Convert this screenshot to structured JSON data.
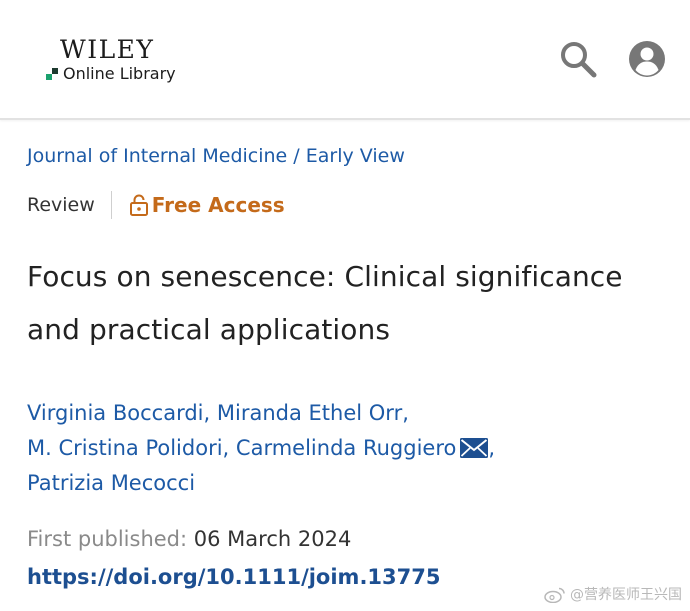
{
  "header": {
    "logo_brand": "WILEY",
    "logo_product": "Online Library",
    "search_icon": "search-icon",
    "account_icon": "account-circle-icon"
  },
  "breadcrumb": {
    "journal": "Journal of Internal Medicine",
    "separator": "/",
    "section": "Early View"
  },
  "article": {
    "type": "Review",
    "access_label": "Free Access",
    "access_icon": "unlock-icon",
    "title": "Focus on senescence: Clinical significance and practical applications",
    "authors": [
      "Virginia Boccardi",
      "Miranda Ethel Orr",
      "M. Cristina Polidori",
      "Carmelinda Ruggiero",
      "Patrizia Mecocci"
    ],
    "author_separator": ",",
    "corresponding_icon": "mail-icon",
    "published_label": "First published:",
    "published_date": "06 March 2024",
    "doi": "https://doi.org/10.1111/joim.13775"
  },
  "watermark": {
    "text": "@营养医师王兴国",
    "icon": "weibo-icon"
  },
  "colors": {
    "link": "#1d5aa6",
    "doi": "#1d4f91",
    "access": "#c46a1a",
    "icon_gray": "#777777",
    "logo_green": "#1ba16e"
  }
}
